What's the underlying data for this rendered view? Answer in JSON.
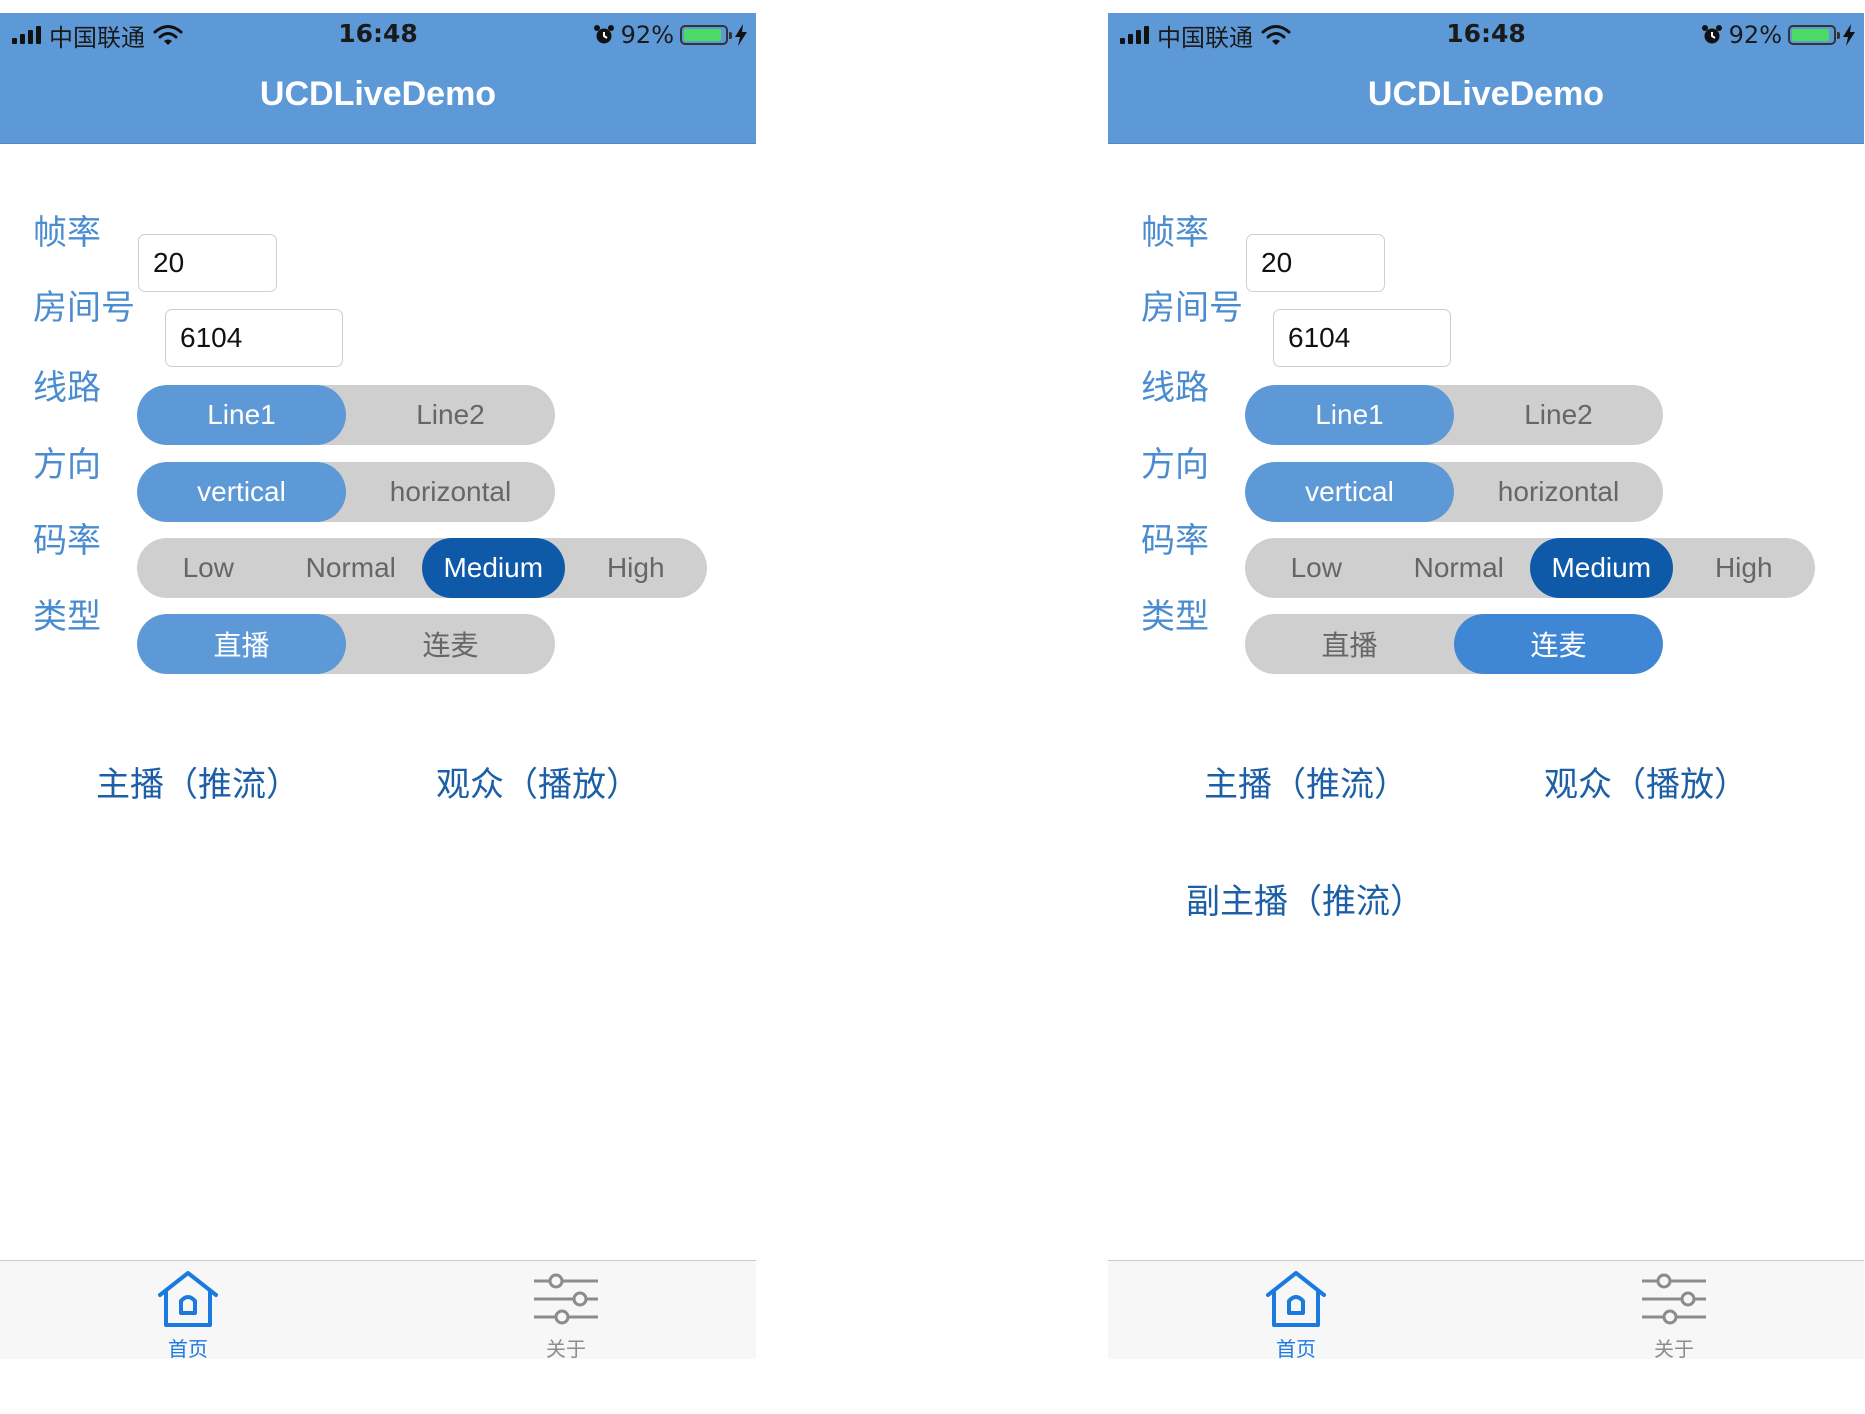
{
  "screens": [
    {
      "status": {
        "carrier": "中国联通",
        "time": "16:48",
        "battery": "92%",
        "battery_level": 0.92
      },
      "title": "UCDLiveDemo",
      "fps": {
        "label": "帧率",
        "value": "20"
      },
      "room": {
        "label": "房间号",
        "value": "6104"
      },
      "line": {
        "label": "线路",
        "options": [
          "Line1",
          "Line2"
        ],
        "selected": "Line1"
      },
      "direction": {
        "label": "方向",
        "options": [
          "vertical",
          "horizontal"
        ],
        "selected": "vertical"
      },
      "bitrate": {
        "label": "码率",
        "options": [
          "Low",
          "Normal",
          "Medium",
          "High"
        ],
        "selected": "Medium"
      },
      "type": {
        "label": "类型",
        "options": [
          "直播",
          "连麦"
        ],
        "selected": "直播"
      },
      "actions": {
        "anchor": "主播（推流）",
        "audience": "观众（播放）"
      },
      "tabs": [
        {
          "label": "首页",
          "icon": "home-icon",
          "active": true
        },
        {
          "label": "关于",
          "icon": "sliders-icon",
          "active": false
        }
      ]
    },
    {
      "status": {
        "carrier": "中国联通",
        "time": "16:48",
        "battery": "92%",
        "battery_level": 0.92
      },
      "title": "UCDLiveDemo",
      "fps": {
        "label": "帧率",
        "value": "20"
      },
      "room": {
        "label": "房间号",
        "value": "6104"
      },
      "line": {
        "label": "线路",
        "options": [
          "Line1",
          "Line2"
        ],
        "selected": "Line1"
      },
      "direction": {
        "label": "方向",
        "options": [
          "vertical",
          "horizontal"
        ],
        "selected": "vertical"
      },
      "bitrate": {
        "label": "码率",
        "options": [
          "Low",
          "Normal",
          "Medium",
          "High"
        ],
        "selected": "Medium"
      },
      "type": {
        "label": "类型",
        "options": [
          "直播",
          "连麦"
        ],
        "selected": "连麦"
      },
      "actions": {
        "anchor": "主播（推流）",
        "audience": "观众（播放）",
        "co_anchor": "副主播（推流）"
      },
      "tabs": [
        {
          "label": "首页",
          "icon": "home-icon",
          "active": true
        },
        {
          "label": "关于",
          "icon": "sliders-icon",
          "active": false
        }
      ]
    }
  ],
  "colors": {
    "header": "#5e99d7",
    "label_blue": "#4a8ccf",
    "action_blue": "#1c5fa6",
    "segment_bg": "#cfcfcf",
    "segment_selected": "#5e99d7",
    "segment_selected_dark": "#0f5aa8",
    "segment_selected_bright": "#3f87d4",
    "tab_active": "#1a7ae0",
    "tab_inactive": "#8c8c8c",
    "battery_green": "#4cd964"
  }
}
